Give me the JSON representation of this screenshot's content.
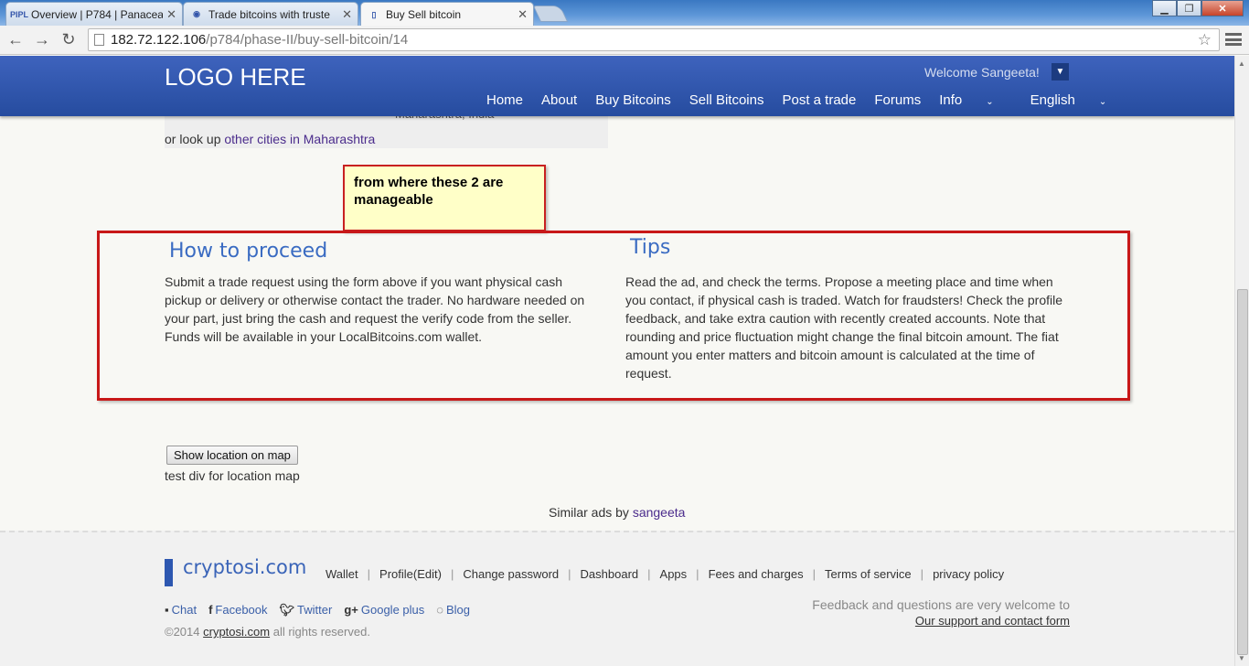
{
  "browser": {
    "tabs": [
      {
        "title": "Overview | P784 | Panacea",
        "favicon": "PIPL"
      },
      {
        "title": "Trade bitcoins with truste",
        "favicon": "◉"
      },
      {
        "title": "Buy Sell bitcoin",
        "favicon": ""
      }
    ],
    "url_host": "182.72.122.106",
    "url_path": "/p784/phase-II/buy-sell-bitcoin/14"
  },
  "header": {
    "logo": "LOGO HERE",
    "welcome": "Welcome Sangeeta!",
    "nav": [
      "Home",
      "About",
      "Buy Bitcoins",
      "Sell Bitcoins",
      "Post a trade",
      "Forums",
      "Info",
      "English"
    ]
  },
  "location": {
    "city": "Maharashtra, India",
    "lookup_prefix": "or look up",
    "lookup_link": "other cities in Maharashtra"
  },
  "annotation": {
    "note": "from where these 2 are manageable"
  },
  "how_to_proceed": {
    "title": "How to proceed",
    "text": "Submit a trade request using the form above if you want physical cash pickup or delivery or otherwise contact the trader. No hardware needed on your part, just bring the cash and request the verify code from the seller. Funds will be available in your LocalBitcoins.com wallet."
  },
  "tips": {
    "title": "Tips",
    "text": "Read the ad, and check the terms. Propose a meeting place and time when you contact, if physical cash is traded. Watch for fraudsters! Check the profile feedback, and take extra caution with recently created accounts. Note that rounding and price fluctuation might change the final bitcoin amount. The fiat amount you enter matters and bitcoin amount is calculated at the time of request."
  },
  "map": {
    "button": "Show location on map",
    "test_div": "test div for location map"
  },
  "similar": {
    "prefix": "Similar ads by",
    "user": "sangeeta"
  },
  "footer": {
    "logo": "cryptosi.com",
    "links": [
      "Wallet",
      "Profile(Edit)",
      "Change password",
      "Dashboard",
      "Apps",
      "Fees and charges",
      "Terms of service",
      "privacy policy"
    ],
    "social": [
      "Chat",
      "Facebook",
      "Twitter",
      "Google plus",
      "Blog"
    ],
    "copyright_prefix": "©2014",
    "copyright_link": "cryptosi.com",
    "copyright_suffix": "all rights reserved.",
    "feedback_text": "Feedback and questions are very welcome to",
    "feedback_link": "Our support and contact form"
  }
}
